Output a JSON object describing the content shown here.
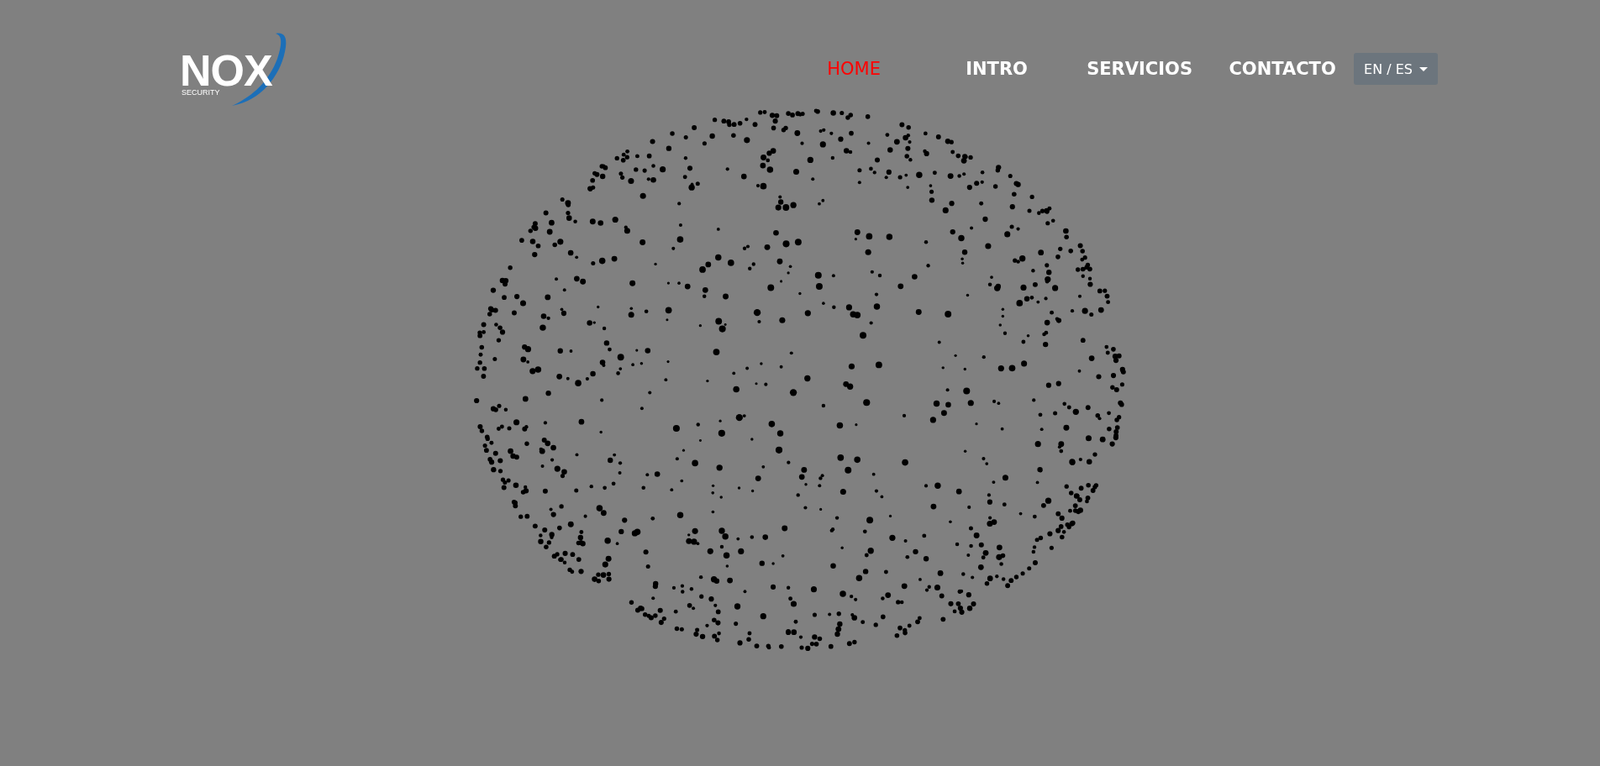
{
  "logo": {
    "name": "NOX",
    "tagline": "SECURITY"
  },
  "nav": [
    {
      "label": "HOME",
      "selected": true
    },
    {
      "label": "INTRO",
      "selected": false
    },
    {
      "label": "SERVICIOS",
      "selected": false
    },
    {
      "label": "CONTACTO",
      "selected": false
    }
  ],
  "language": {
    "label": "EN / ES"
  }
}
